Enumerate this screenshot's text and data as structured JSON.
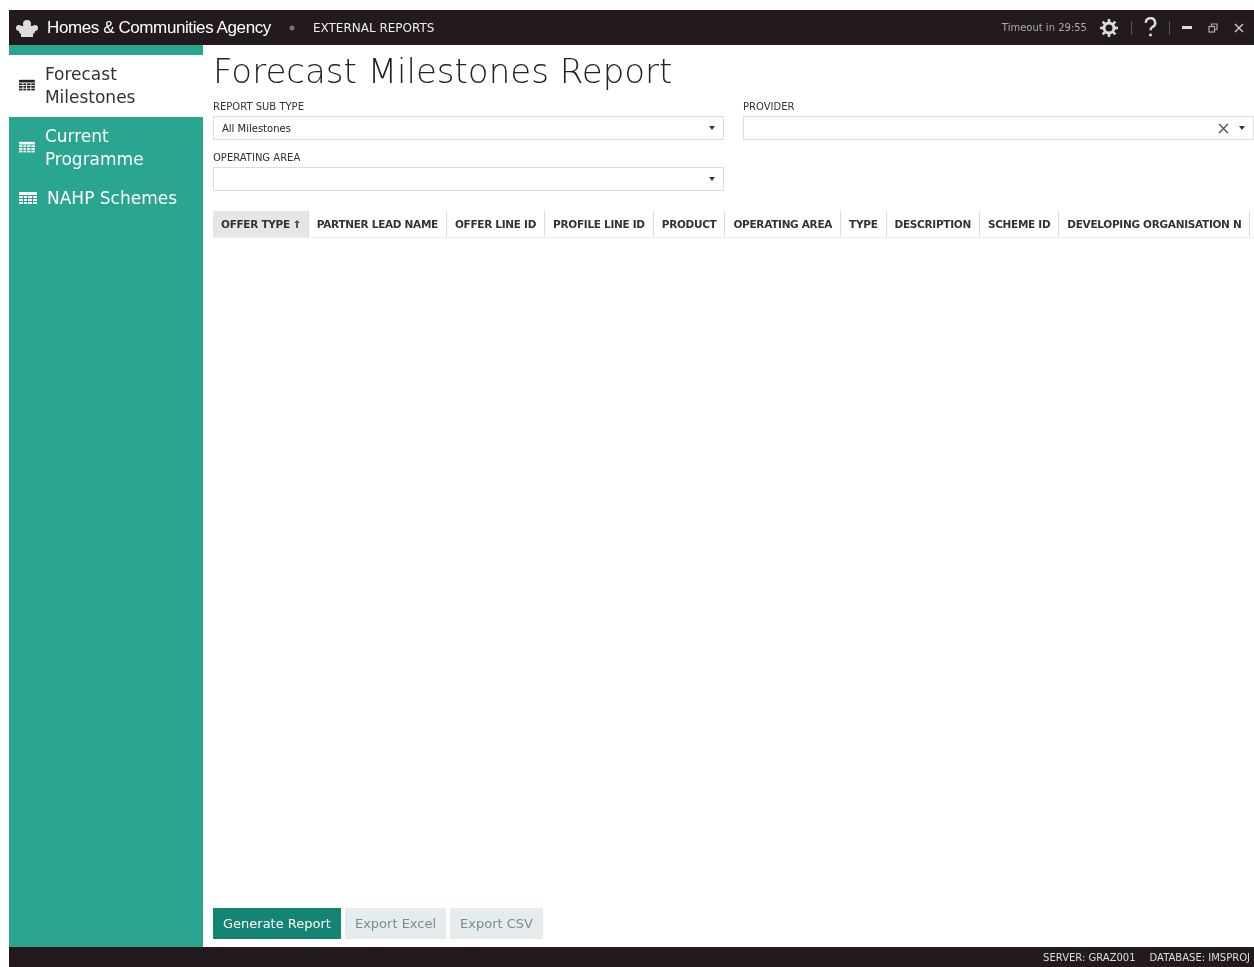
{
  "title_bar": {
    "agency": "Homes & Communities Agency",
    "section": "EXTERNAL REPORTS",
    "timeout": "Timeout in 29:55"
  },
  "sidebar": {
    "items": [
      {
        "label": "Forecast Milestones",
        "selected": true
      },
      {
        "label": "Current Programme",
        "selected": false
      },
      {
        "label": "NAHP Schemes",
        "selected": false
      }
    ]
  },
  "page_title": "Forecast Milestones Report",
  "filters": [
    {
      "label": "REPORT SUB TYPE",
      "value": "All Milestones",
      "clearable": false
    },
    {
      "label": "PROVIDER",
      "clearable": true
    },
    {
      "label": "OPERATING AREA",
      "clearable": false
    }
  ],
  "table": {
    "columns": [
      {
        "label": "OFFER TYPE",
        "sorted": true
      },
      {
        "label": "PARTNER LEAD NAME",
        "sorted": false
      },
      {
        "label": "OFFER LINE ID",
        "sorted": false
      },
      {
        "label": "PROFILE LINE ID",
        "sorted": false
      },
      {
        "label": "PRODUCT",
        "sorted": false
      },
      {
        "label": "OPERATING AREA",
        "sorted": false
      },
      {
        "label": "TYPE",
        "sorted": false
      },
      {
        "label": "DESCRIPTION",
        "sorted": false
      },
      {
        "label": "SCHEME ID",
        "sorted": false
      },
      {
        "label": "DEVELOPING ORGANISATION N",
        "sorted": false
      }
    ]
  },
  "buttons": [
    {
      "label": "Generate Report",
      "disabled": false
    },
    {
      "label": "Export Excel",
      "disabled": true
    },
    {
      "label": "Export CSV",
      "disabled": true
    }
  ],
  "status_bar": {
    "server": "SERVER: GRAZ001",
    "database": "DATABASE: IMSPROJ"
  }
}
